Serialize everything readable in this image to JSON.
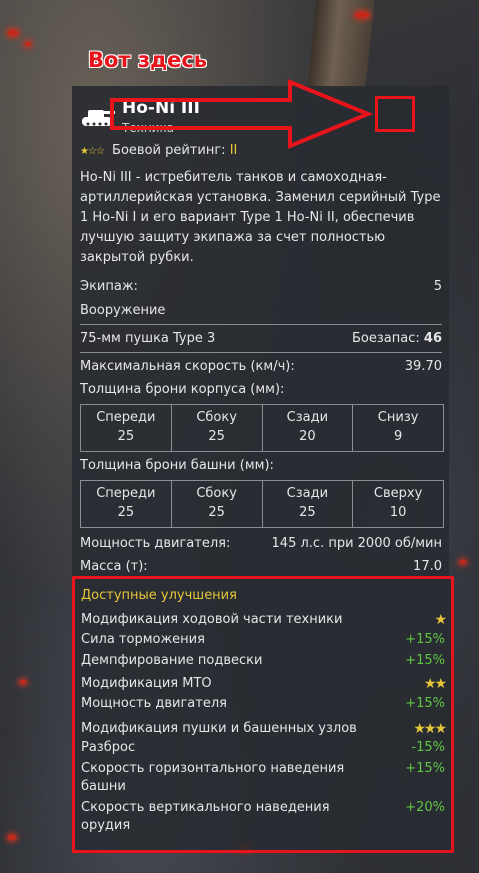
{
  "annotation": {
    "label": "Вот здесь",
    "color": "#e8141b"
  },
  "vehicle": {
    "name": "Ho-Ni III",
    "type": "Техника",
    "rating_label": "Боевой рейтинг:",
    "tier": "II",
    "description": "Ho-Ni III - истребитель танков и самоходная-артиллерийская установка. Заменил серийный Type 1 Ho-Ni I и его вариант Type 1 Ho-Ni II, обеспечив лучшую защиту экипажа за счет полностью закрытой рубки."
  },
  "stats": {
    "crew_label": "Экипаж:",
    "crew_value": "5",
    "armament_label": "Вооружение",
    "gun": "75-мм пушка Type 3",
    "ammo_label": "Боезапас:",
    "ammo_value": "46",
    "speed_label": "Максимальная скорость (км/ч):",
    "speed_value": "39.70",
    "hull_label": "Толщина брони корпуса (мм):",
    "hull": [
      {
        "label": "Спереди",
        "value": "25"
      },
      {
        "label": "Сбоку",
        "value": "25"
      },
      {
        "label": "Сзади",
        "value": "20"
      },
      {
        "label": "Снизу",
        "value": "9"
      }
    ],
    "turret_label": "Толщина брони башни (мм):",
    "turret": [
      {
        "label": "Спереди",
        "value": "25"
      },
      {
        "label": "Сбоку",
        "value": "25"
      },
      {
        "label": "Сзади",
        "value": "25"
      },
      {
        "label": "Сверху",
        "value": "10"
      }
    ],
    "engine_label": "Мощность двигателя:",
    "engine_value": "145 л.с. при 2000 об/мин",
    "mass_label": "Масса (т):",
    "mass_value": "17.0"
  },
  "upgrades": {
    "title": "Доступные улучшения",
    "items": [
      {
        "name": "Модификация ходовой части техники",
        "stars": "★"
      },
      {
        "name": "Сила торможения",
        "value": "+15%"
      },
      {
        "name": "Демпфирование подвески",
        "value": "+15%"
      },
      {
        "name": "Модификация МТО",
        "stars": "★★"
      },
      {
        "name": "Мощность двигателя",
        "value": "+15%"
      },
      {
        "name": "Модификация пушки и башенных узлов",
        "stars": "★★★"
      },
      {
        "name": "Разброс",
        "value": "-15%"
      },
      {
        "name": "Скорость горизонтального наведения башни",
        "value": "+15%"
      },
      {
        "name": "Скорость вертикального наведения орудия",
        "value": "+20%"
      }
    ]
  }
}
